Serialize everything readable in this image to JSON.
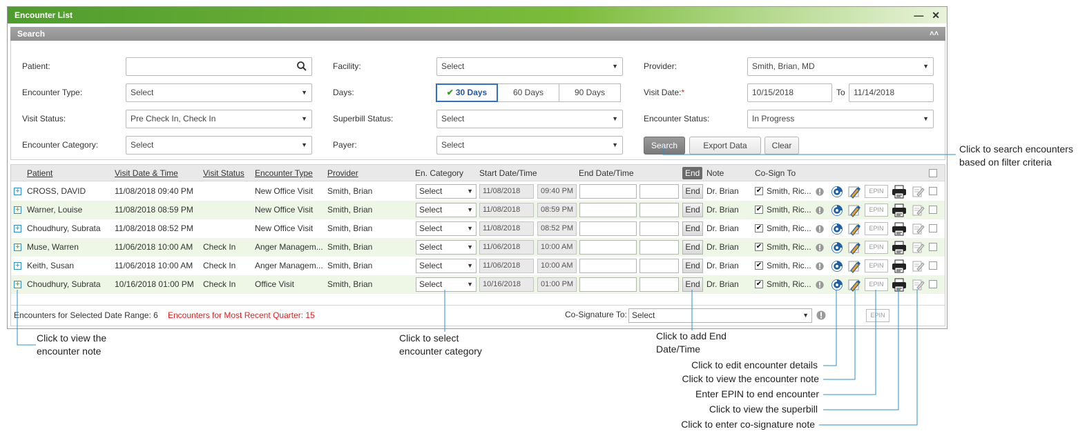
{
  "window": {
    "title": "Encounter List"
  },
  "search": {
    "title": "Search",
    "patient": {
      "label": "Patient:",
      "value": ""
    },
    "facility": {
      "label": "Facility:",
      "value": "Select"
    },
    "provider": {
      "label": "Provider:",
      "value": "Smith, Brian, MD"
    },
    "encounter_type": {
      "label": "Encounter Type:",
      "value": "Select"
    },
    "days": {
      "label": "Days:",
      "options": [
        "30 Days",
        "60 Days",
        "90 Days"
      ],
      "selected": "30 Days"
    },
    "visit_date": {
      "label": "Visit Date:",
      "required_mark": "*",
      "from": "10/15/2018",
      "to_label": "To",
      "to": "11/14/2018"
    },
    "visit_status": {
      "label": "Visit Status:",
      "value": "Pre Check In, Check In"
    },
    "superbill_status": {
      "label": "Superbill Status:",
      "value": "Select"
    },
    "encounter_status": {
      "label": "Encounter Status:",
      "value": "In Progress"
    },
    "encounter_category": {
      "label": "Encounter Category:",
      "value": "Select"
    },
    "payer": {
      "label": "Payer:",
      "value": "Select"
    },
    "buttons": {
      "search": "Search",
      "export": "Export Data",
      "clear": "Clear"
    }
  },
  "grid": {
    "columns": {
      "patient": "Patient",
      "visit_date": "Visit Date & Time",
      "visit_status": "Visit Status",
      "encounter_type": "Encounter Type",
      "provider": "Provider",
      "en_category": "En. Category",
      "start": "Start Date/Time",
      "end": "End Date/Time",
      "end_btn": "End",
      "note": "Note",
      "cosign": "Co-Sign To"
    },
    "rows": [
      {
        "patient": "CROSS, DAVID",
        "visit": "11/08/2018 09:40 PM",
        "status": "",
        "type": "New Office Visit",
        "provider": "Smith, Brian",
        "category": "Select",
        "start_date": "11/08/2018",
        "start_time": "09:40 PM",
        "end_label": "End",
        "note": "Dr. Brian",
        "cosign": "Smith, Ric...",
        "epin": "EPIN"
      },
      {
        "patient": "Warner, Louise",
        "visit": "11/08/2018 08:59 PM",
        "status": "",
        "type": "New Office Visit",
        "provider": "Smith, Brian",
        "category": "Select",
        "start_date": "11/08/2018",
        "start_time": "08:59 PM",
        "end_label": "End",
        "note": "Dr. Brian",
        "cosign": "Smith, Ric...",
        "epin": "EPIN"
      },
      {
        "patient": "Choudhury, Subrata",
        "visit": "11/08/2018 08:52 PM",
        "status": "",
        "type": "New Office Visit",
        "provider": "Smith, Brian",
        "category": "Select",
        "start_date": "11/08/2018",
        "start_time": "08:52 PM",
        "end_label": "End",
        "note": "Dr. Brian",
        "cosign": "Smith, Ric...",
        "epin": "EPIN"
      },
      {
        "patient": "Muse, Warren",
        "visit": "11/06/2018 10:00 AM",
        "status": "Check In",
        "type": "Anger Managem...",
        "provider": "Smith, Brian",
        "category": "Select",
        "start_date": "11/06/2018",
        "start_time": "10:00 AM",
        "end_label": "End",
        "note": "Dr. Brian",
        "cosign": "Smith, Ric...",
        "epin": "EPIN"
      },
      {
        "patient": "Keith, Susan",
        "visit": "11/06/2018 10:00 AM",
        "status": "Check In",
        "type": "Anger Managem...",
        "provider": "Smith, Brian",
        "category": "Select",
        "start_date": "11/06/2018",
        "start_time": "10:00 AM",
        "end_label": "End",
        "note": "Dr. Brian",
        "cosign": "Smith, Ric...",
        "epin": "EPIN"
      },
      {
        "patient": "Choudhury, Subrata",
        "visit": "10/16/2018 01:00 PM",
        "status": "Check In",
        "type": "Office Visit",
        "provider": "Smith, Brian",
        "category": "Select",
        "start_date": "10/16/2018",
        "start_time": "01:00 PM",
        "end_label": "End",
        "note": "Dr. Brian",
        "cosign": "Smith, Ric...",
        "epin": "EPIN"
      }
    ],
    "footer": {
      "selected_range": "Encounters for Selected Date Range: 6",
      "recent_quarter": "Encounters for Most Recent Quarter: 15",
      "cosign_label": "Co-Signature To:",
      "cosign_value": "Select",
      "epin": "EPIN"
    }
  },
  "callouts": {
    "search": [
      "Click to search encounters",
      "based on filter criteria"
    ],
    "view_note": [
      "Click to view the",
      "encounter note"
    ],
    "category": [
      "Click to select",
      "encounter category"
    ],
    "end": [
      "Click to add End",
      "Date/Time"
    ],
    "edit": "Click to edit encounter details",
    "view_note2": "Click to view the encounter note",
    "epin": "Enter EPIN to end encounter",
    "superbill": "Click to view the superbill",
    "cosign": "Click to enter co-signature note"
  },
  "colors": {
    "accent_green": "#7cbc3b",
    "callout_line": "#2d8fd0",
    "quarter_red": "#e02020"
  }
}
